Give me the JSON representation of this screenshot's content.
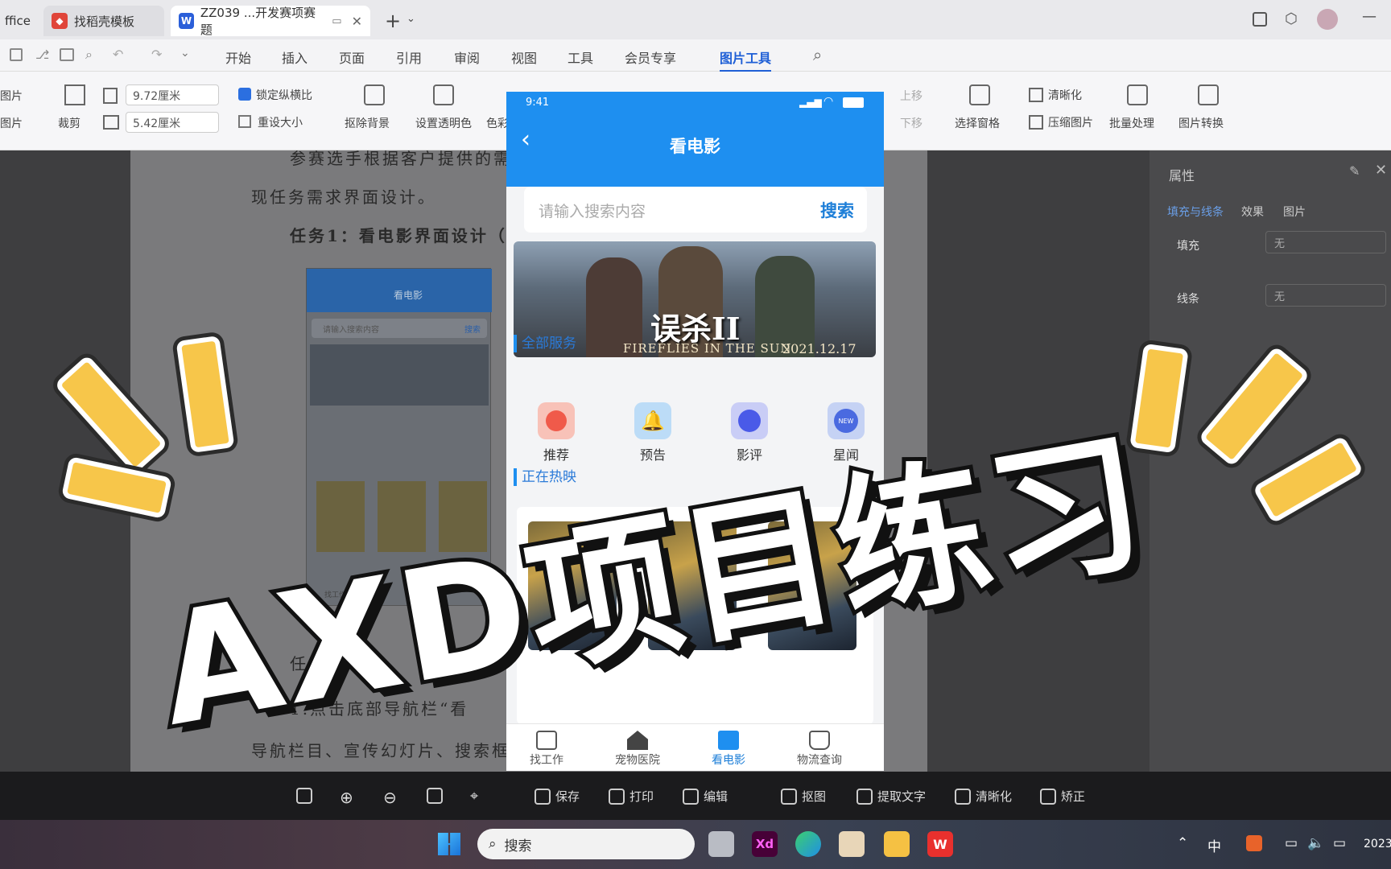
{
  "browser_tabs": [
    {
      "label": "ffice",
      "active": false
    },
    {
      "label": "找稻壳模板",
      "active": false
    },
    {
      "label": "ZZ039 ...开发赛项赛题",
      "active": true
    }
  ],
  "menu": [
    "开始",
    "插入",
    "页面",
    "引用",
    "审阅",
    "视图",
    "工具",
    "会员专享",
    "图片工具"
  ],
  "ribbon": {
    "left_labels": [
      "图片",
      "图片"
    ],
    "crop": "裁剪",
    "width": "9.72厘米",
    "height": "5.42厘米",
    "lock_ratio": "锁定纵横比",
    "reset_size": "重设大小",
    "remove_bg": "抠除背景",
    "set_transparent": "设置透明色",
    "color": "色彩",
    "up": "上移",
    "down": "下移",
    "select_pane": "选择窗格",
    "sharpen": "清晰化",
    "compress": "压缩图片",
    "batch": "批量处理",
    "convert": "图片转换"
  },
  "document": {
    "line1": "参赛选手根据客户提供的需",
    "line2": "现任务需求界面设计。",
    "line3": "任务1：看电影界面设计（",
    "line4": "任务说",
    "line5": "1.点击底部导航栏“看",
    "line6": "导航栏目、宣传幻灯片、搜索框"
  },
  "thumbnail": {
    "title": "看电影",
    "search_placeholder": "请输入搜索内容",
    "search_btn": "搜索",
    "tab1": "找工作"
  },
  "properties_panel": {
    "title": "属性",
    "tabs": [
      "填充与线条",
      "效果",
      "图片"
    ],
    "fill_label": "填充",
    "fill_value": "无",
    "line_label": "线条",
    "line_value": "无"
  },
  "phone": {
    "time": "9:41",
    "title": "看电影",
    "search_placeholder": "请输入搜索内容",
    "search_button": "搜索",
    "banner_title": "误杀II",
    "banner_subtitle": "FIREFLIES IN THE SUN",
    "banner_date": "2021.12.17",
    "section_services": "全部服务",
    "services": [
      {
        "label": "推荐",
        "icon": "fire-icon",
        "color": "#f05a4a"
      },
      {
        "label": "预告",
        "icon": "bell-icon",
        "color": "#2b8be8"
      },
      {
        "label": "影评",
        "icon": "chat-icon",
        "color": "#4a5ae8"
      },
      {
        "label": "星闻",
        "icon": "new-badge-icon",
        "color": "#4a6ae0"
      }
    ],
    "section_hot": "正在热映",
    "bottom_tabs": [
      {
        "label": "找工作",
        "active": false
      },
      {
        "label": "宠物医院",
        "active": false
      },
      {
        "label": "看电影",
        "active": true
      },
      {
        "label": "物流查询",
        "active": false
      }
    ]
  },
  "image_toolbar": [
    "保存",
    "打印",
    "编辑",
    "抠图",
    "提取文字",
    "清晰化",
    "矫正"
  ],
  "taskbar": {
    "search_text": "搜索",
    "ime": "中",
    "clock": "2023"
  },
  "overlay": {
    "title": "AXD项目练习"
  }
}
